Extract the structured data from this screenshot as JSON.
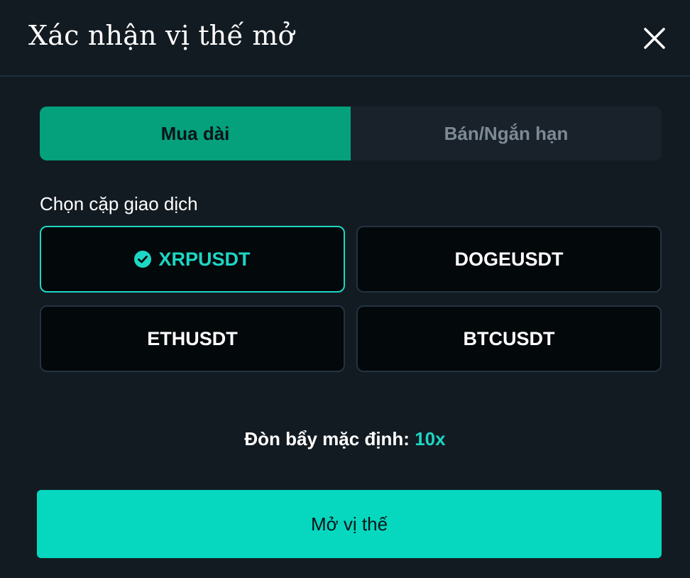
{
  "dialog": {
    "title": "Xác nhận vị thế mở",
    "close_icon": "close-icon"
  },
  "tabs": [
    {
      "label": "Mua dài",
      "active": true
    },
    {
      "label": "Bán/Ngắn hạn",
      "active": false
    }
  ],
  "pairs": {
    "label": "Chọn cặp giao dịch",
    "items": [
      {
        "symbol": "XRPUSDT",
        "selected": true
      },
      {
        "symbol": "DOGEUSDT",
        "selected": false
      },
      {
        "symbol": "ETHUSDT",
        "selected": false
      },
      {
        "symbol": "BTCUSDT",
        "selected": false
      }
    ],
    "selected_icon": "check-circle-icon"
  },
  "leverage": {
    "label": "Đòn bẩy mặc định:",
    "value": "10x"
  },
  "submit": {
    "label": "Mở vị thế"
  },
  "colors": {
    "background": "#131b22",
    "accent_teal": "#05d8bf",
    "selected_border": "#1dd6c3",
    "long_tab": "#05a07c",
    "card_bg": "#03080b"
  }
}
